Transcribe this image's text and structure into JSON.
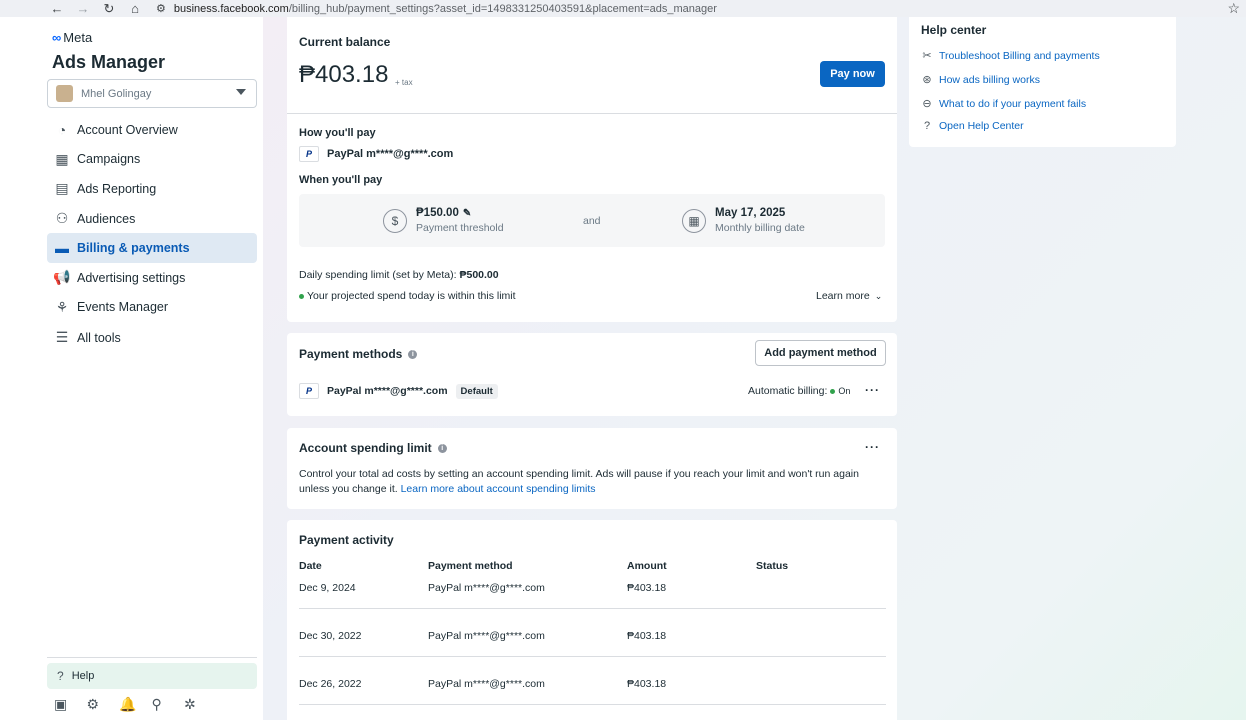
{
  "browser": {
    "url_host": "business.facebook.com",
    "url_path": "/billing_hub/payment_settings?asset_id=1498331250403591&placement=ads_manager"
  },
  "sidebar": {
    "brand": "Meta",
    "app_title": "Ads Manager",
    "account_name": "Mhel Golingay",
    "items": [
      {
        "label": "Account Overview",
        "icon": "gauge-icon"
      },
      {
        "label": "Campaigns",
        "icon": "table-icon"
      },
      {
        "label": "Ads Reporting",
        "icon": "report-icon"
      },
      {
        "label": "Audiences",
        "icon": "people-icon"
      },
      {
        "label": "Billing & payments",
        "icon": "card-icon",
        "active": true
      },
      {
        "label": "Advertising settings",
        "icon": "megaphone-icon"
      },
      {
        "label": "Events Manager",
        "icon": "events-icon"
      },
      {
        "label": "All tools",
        "icon": "menu-icon"
      }
    ],
    "help_label": "Help"
  },
  "balance": {
    "title": "Current balance",
    "amount": "₱403.18",
    "tax_note": "+ tax",
    "pay_now": "Pay now",
    "how_title": "How you'll pay",
    "how_method": "PayPal m****@g****.com",
    "when_title": "When you'll pay",
    "threshold_value": "₱150.00",
    "threshold_label": "Payment threshold",
    "and_label": "and",
    "date_value": "May 17, 2025",
    "date_label": "Monthly billing date",
    "daily_limit_text": "Daily spending limit (set by Meta):",
    "daily_limit_value": "₱500.00",
    "projected_text": "Your projected spend today is within this limit",
    "learn_more": "Learn more"
  },
  "payment_methods": {
    "title": "Payment methods",
    "add_button": "Add payment method",
    "method": "PayPal m****@g****.com",
    "default_badge": "Default",
    "auto_billing_label": "Automatic billing:",
    "auto_billing_state": "On"
  },
  "spending_limit": {
    "title": "Account spending limit",
    "desc": "Control your total ad costs by setting an account spending limit. Ads will pause if you reach your limit and won't run again unless you change it.",
    "link": "Learn more about account spending limits"
  },
  "activity": {
    "title": "Payment activity",
    "headers": {
      "date": "Date",
      "method": "Payment method",
      "amount": "Amount",
      "status": "Status"
    },
    "rows": [
      {
        "date": "Dec 9, 2024",
        "method": "PayPal m****@g****.com",
        "amount": "₱403.18"
      },
      {
        "date": "Dec 30, 2022",
        "method": "PayPal m****@g****.com",
        "amount": "₱403.18"
      },
      {
        "date": "Dec 26, 2022",
        "method": "PayPal m****@g****.com",
        "amount": "₱403.18"
      }
    ]
  },
  "help_center": {
    "title": "Help center",
    "links": [
      {
        "label": "Troubleshoot Billing and payments",
        "icon": "tools-icon"
      },
      {
        "label": "How ads billing works",
        "icon": "billing-icon"
      },
      {
        "label": "What to do if your payment fails",
        "icon": "minus-circle-icon"
      },
      {
        "label": "Open Help Center",
        "icon": "question-icon"
      }
    ]
  }
}
